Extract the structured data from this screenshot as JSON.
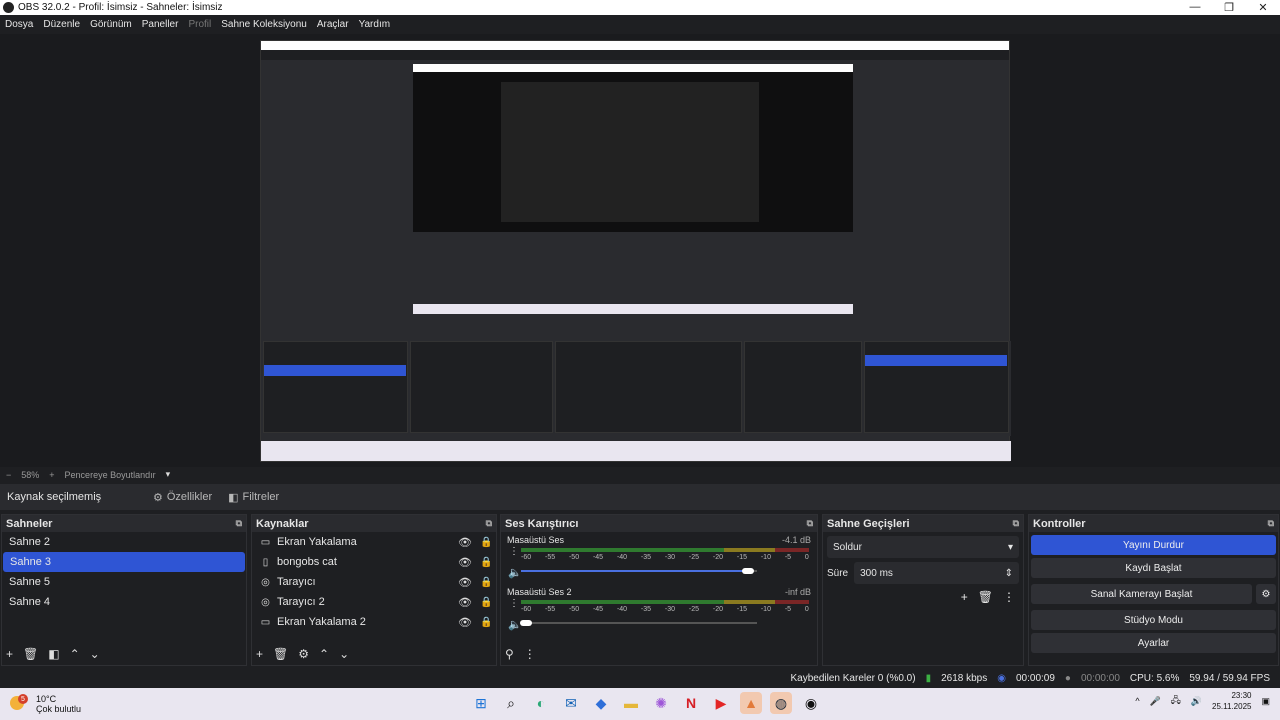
{
  "window": {
    "title": "OBS 32.0.2 - Profil: İsimsiz - Sahneler: İsimsiz",
    "controls": [
      "—",
      "❐",
      "✕"
    ]
  },
  "menu": {
    "items": [
      "Dosya",
      "Düzenle",
      "Görünüm",
      "Paneller",
      "Profil",
      "Sahne Koleksiyonu",
      "Araçlar",
      "Yardım"
    ]
  },
  "zoom": {
    "minus": "−",
    "value": "58%",
    "plus": "+",
    "fit": "Pencereye Boyutlandır",
    "chevron": "▾"
  },
  "source_bar": {
    "label": "Kaynak seçilmemiş",
    "properties": "Özellikler",
    "filters": "Filtreler",
    "properties_icon": "⚙",
    "filters_icon": "◧"
  },
  "scenes": {
    "title": "Sahneler",
    "items": [
      "Sahne 2",
      "Sahne 3",
      "Sahne 5",
      "Sahne 4"
    ],
    "selected_index": 1
  },
  "sources": {
    "title": "Kaynaklar",
    "items": [
      {
        "name": "Ekran Yakalama",
        "icon": "monitor-icon",
        "glyph": "▭"
      },
      {
        "name": "bongobs cat",
        "icon": "file-icon",
        "glyph": "▯"
      },
      {
        "name": "Tarayıcı",
        "icon": "globe-icon",
        "glyph": "◎"
      },
      {
        "name": "Tarayıcı 2",
        "icon": "globe-icon",
        "glyph": "◎"
      },
      {
        "name": "Ekran Yakalama 2",
        "icon": "monitor-icon",
        "glyph": "▭"
      }
    ]
  },
  "mixer": {
    "title": "Ses Karıştırıcı",
    "channels": [
      {
        "name": "Masaüstü Ses",
        "db": "-4.1 dB",
        "volume_fraction": 0.96
      },
      {
        "name": "Masaüstü Ses 2",
        "db": "-inf dB",
        "volume_fraction": 0.02
      }
    ],
    "ticks": [
      "-60",
      "-55",
      "-50",
      "-45",
      "-40",
      "-35",
      "-30",
      "-25",
      "-20",
      "-15",
      "-10",
      "-5",
      "0"
    ]
  },
  "transitions": {
    "title": "Sahne Geçişleri",
    "selected": "Soldur",
    "duration_label": "Süre",
    "duration": "300 ms"
  },
  "controls": {
    "title": "Kontroller",
    "buttons": [
      "Yayını Durdur",
      "Kaydı Başlat",
      "Sanal Kamerayı Başlat",
      "Stüdyo Modu",
      "Ayarlar"
    ]
  },
  "status": {
    "dropped": "Kaybedilen Kareler 0 (%0.0)",
    "kbps": "2618 kbps",
    "stream_time": "00:00:09",
    "rec_time": "00:00:00",
    "cpu": "CPU: 5.6%",
    "fps": "59.94 / 59.94 FPS"
  },
  "taskbar": {
    "temp": "10°C",
    "weather": "Çok bulutlu",
    "weather_badge": "5",
    "time": "23:30",
    "date": "25.11.2025",
    "tray": [
      "^",
      "🎤",
      "🖧",
      "🔊"
    ]
  },
  "colors": {
    "accent": "#2f55d4",
    "bg": "#1e1f22",
    "panel": "#2a2b2f"
  }
}
